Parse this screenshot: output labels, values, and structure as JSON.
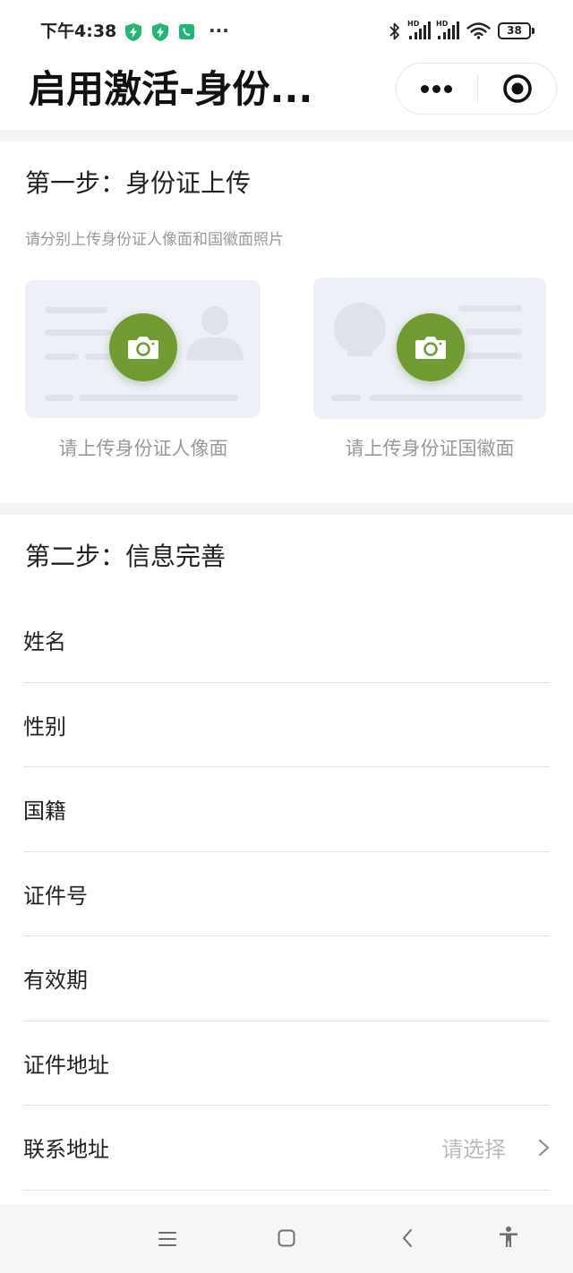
{
  "status_bar": {
    "time": "下午4:38",
    "overflow": "···",
    "signal_1_tag": "HD",
    "signal_2_tag": "HD",
    "battery_level": "38",
    "icons": [
      "shield-bolt-icon",
      "shield-bolt-icon",
      "phone-icon",
      "bluetooth-icon",
      "signal-icon",
      "signal-icon",
      "wifi-icon",
      "battery-icon"
    ]
  },
  "header": {
    "title": "启用激活-身份...",
    "capsule_icons": [
      "more-dots-icon",
      "close-target-icon"
    ]
  },
  "step1": {
    "title": "第一步：身份证上传",
    "hint": "请分别上传身份证人像面和国徽面照片",
    "uploads": [
      {
        "label": "请上传身份证人像面",
        "icon": "camera-icon"
      },
      {
        "label": "请上传身份证国徽面",
        "icon": "camera-icon"
      }
    ]
  },
  "step2": {
    "title": "第二步：信息完善",
    "fields": [
      {
        "label": "姓名"
      },
      {
        "label": "性别"
      },
      {
        "label": "国籍"
      },
      {
        "label": "证件号"
      },
      {
        "label": "有效期"
      },
      {
        "label": "证件地址"
      },
      {
        "label": "联系地址",
        "placeholder": "请选择",
        "icon": "chevron-right-icon"
      }
    ]
  },
  "nav_bar": {
    "icons": [
      "menu-icon",
      "home-square-icon",
      "back-icon",
      "accessibility-icon"
    ]
  },
  "colors": {
    "accent_green": "#6f9b32",
    "status_green": "#22b573",
    "card_bg": "#eef0f7",
    "placeholder_shape": "#dfe2eb",
    "separator": "#f3f4f6",
    "muted_text": "#999999",
    "placeholder_text": "#bbbbbb"
  }
}
